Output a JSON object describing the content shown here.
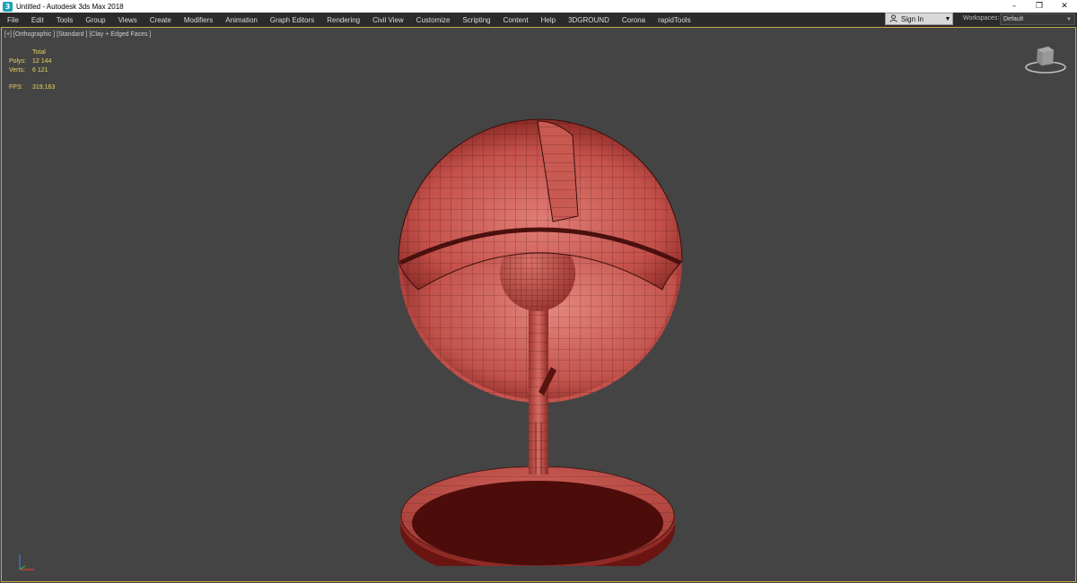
{
  "window": {
    "title": "Untitled - Autodesk 3ds Max 2018",
    "minimize_glyph": "–",
    "restore_glyph": "❐",
    "close_glyph": "✕"
  },
  "menu": [
    "File",
    "Edit",
    "Tools",
    "Group",
    "Views",
    "Create",
    "Modifiers",
    "Animation",
    "Graph Editors",
    "Rendering",
    "Civil View",
    "Customize",
    "Scripting",
    "Content",
    "Help",
    "3DGROUND",
    "Corona",
    "rapidTools"
  ],
  "account": {
    "sign_in_label": "Sign In",
    "icon": "user-icon"
  },
  "workspaces": {
    "label": "Workspaces:",
    "value": "Default"
  },
  "viewport": {
    "label": "[+] [Orthographic ] [Standard ] [Clay + Edged Faces ]",
    "stats": {
      "header": "Total",
      "polys_label": "Polys:",
      "polys_value": "12 144",
      "verts_label": "Verts:",
      "verts_value": "6 121",
      "fps_label": "FPS:",
      "fps_value": "319,163"
    },
    "colors": {
      "border": "#c8a64a",
      "stats_text": "#e5d45a",
      "clay": "#c4504a",
      "wire": "#3a0e0c"
    }
  }
}
